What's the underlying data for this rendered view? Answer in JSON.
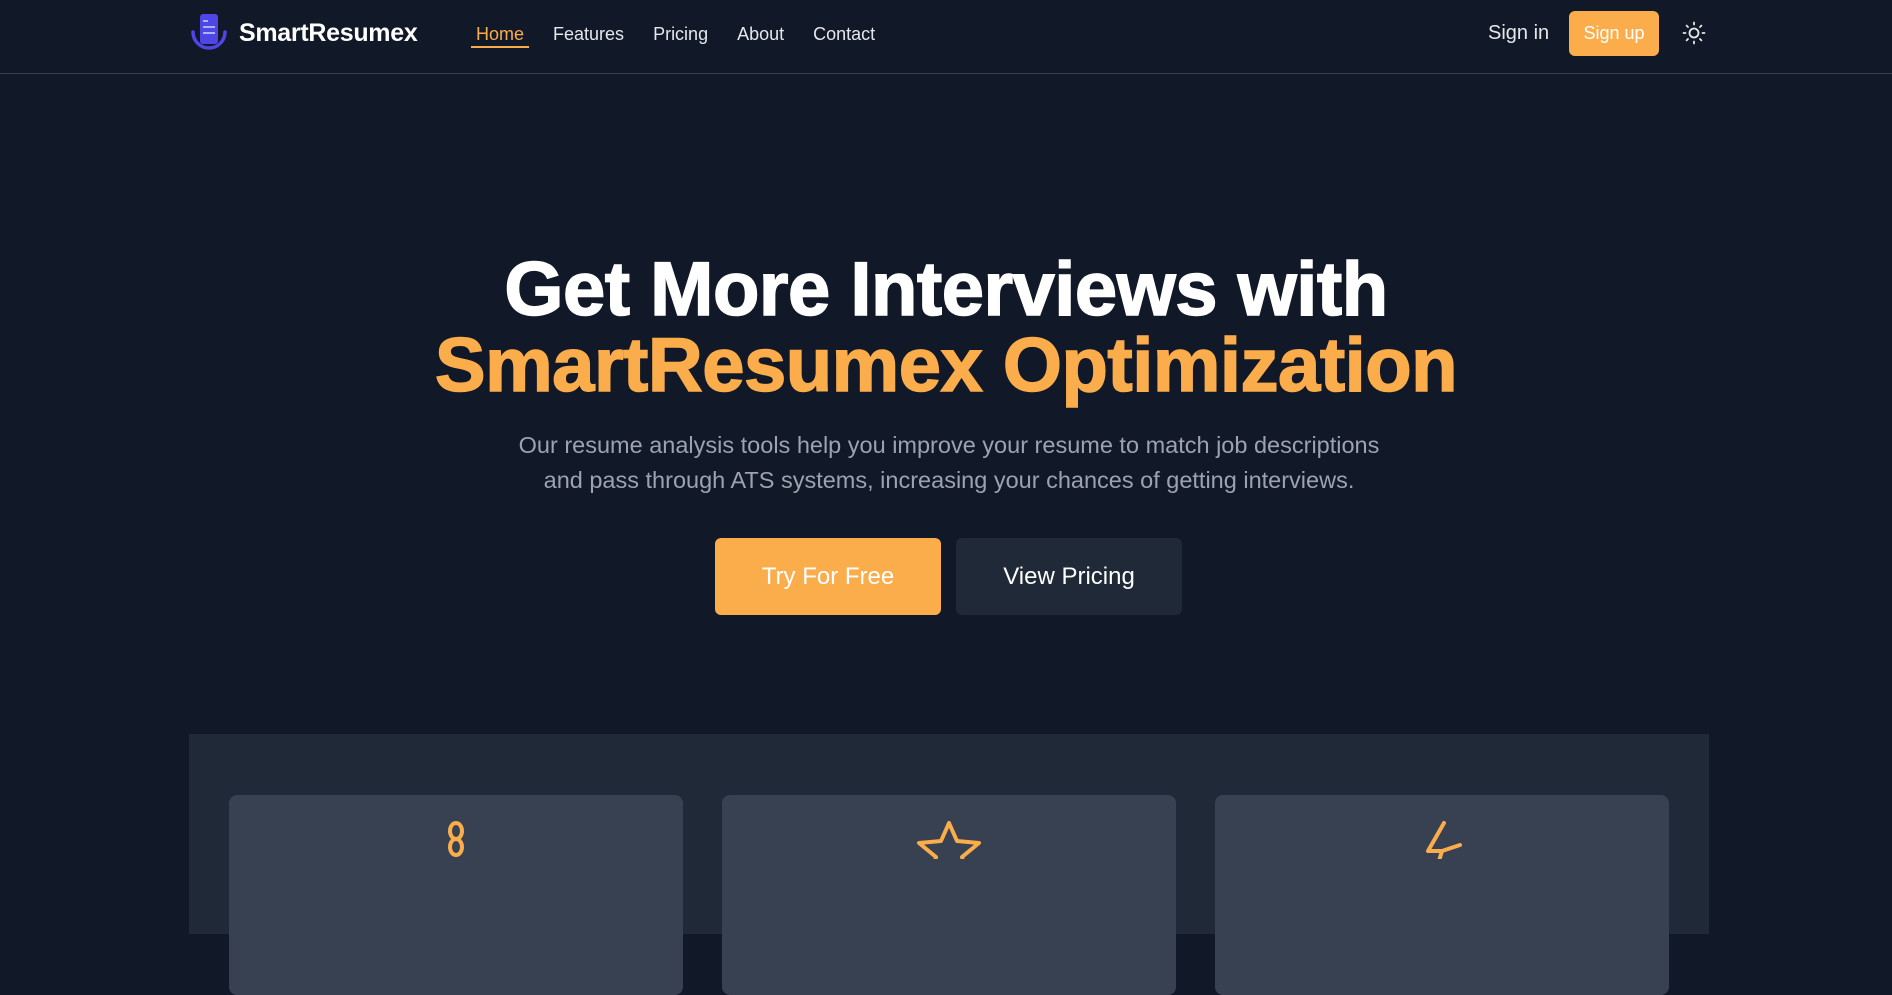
{
  "brand": {
    "name": "SmartResumex",
    "icon": "document-icon"
  },
  "nav": {
    "links": [
      {
        "label": "Home",
        "active": true
      },
      {
        "label": "Features",
        "active": false
      },
      {
        "label": "Pricing",
        "active": false
      },
      {
        "label": "About",
        "active": false
      },
      {
        "label": "Contact",
        "active": false
      }
    ],
    "sign_in": "Sign in",
    "sign_up": "Sign up",
    "theme_icon": "sun-icon"
  },
  "hero": {
    "title_line1": "Get More Interviews with",
    "title_line2": "SmartResumex Optimization",
    "subtitle_line1": "Our resume analysis tools help you improve your resume to match job descriptions",
    "subtitle_line2": "and pass through ATS systems, increasing your chances of getting interviews.",
    "primary_cta": "Try For Free",
    "secondary_cta": "View Pricing"
  },
  "features": {
    "cards": [
      {
        "icon": "link-icon"
      },
      {
        "icon": "star-icon"
      },
      {
        "icon": "lightning-icon"
      }
    ]
  },
  "colors": {
    "background": "#111827",
    "accent": "#fbad4c",
    "surface": "#1f2937",
    "card": "#374151",
    "brand_icon": "#4f46e5",
    "muted_text": "#9ca3af"
  }
}
